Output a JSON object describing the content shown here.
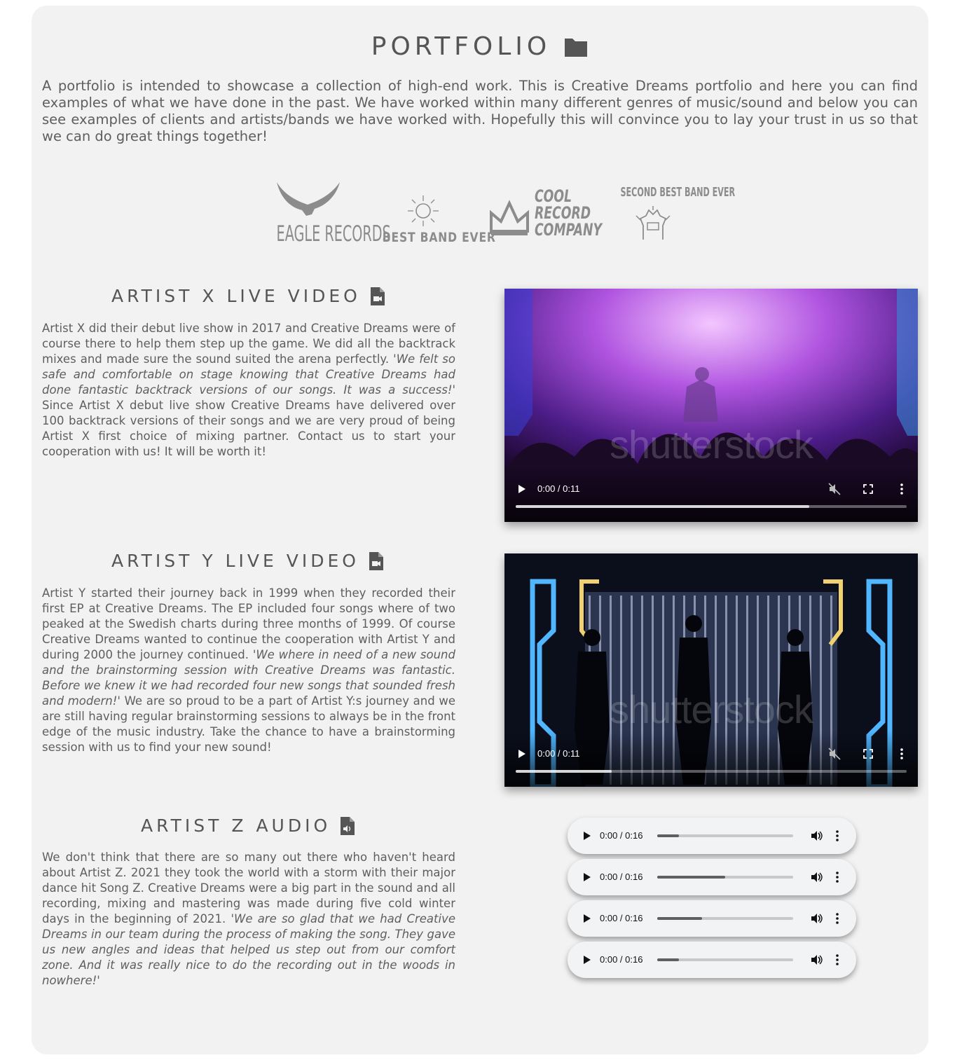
{
  "portfolio": {
    "title": "PORTFOLIO",
    "title_icon": "folder-icon",
    "intro": "A portfolio is intended to showcase a collection of high-end work. This is Creative Dreams portfolio and here you can find examples of what we have done in the past. We have worked within many different genres of music/sound and below you can see examples of clients and artists/bands we have worked with. Hopefully this will convince you to lay your trust in us so that we can do great things together!"
  },
  "logos": {
    "eagle": "EAGLE RECORDS",
    "best_band": "BEST BAND EVER",
    "cool_record": [
      "COOL",
      "RECORD",
      "COMPANY"
    ],
    "second_best": "SECOND BEST BAND EVER"
  },
  "artist_x": {
    "title": "ARTIST X LIVE VIDEO",
    "icon": "file-video-icon",
    "text_before": "Artist X did their debut live show in 2017 and Creative Dreams were of course there to help them step up the game. We did all the backtrack mixes and made sure the sound suited the arena perfectly. ",
    "quote": "'We felt so safe and comfortable on stage knowing that Creative Dreams had done fantastic backtrack versions of our songs. It was a success!'",
    "text_after": " Since Artist X debut live show Creative Dreams have delivered over 100 backtrack versions of their songs and we are very proud of being Artist X first choice of mixing partner. Contact us to start your cooperation with us! It will be worth it!",
    "video": {
      "time": "0:00 / 0:11",
      "watermark": "shutterstock",
      "buffered": 0.75
    }
  },
  "artist_y": {
    "title": "ARTIST Y LIVE VIDEO",
    "icon": "file-video-icon",
    "text_before": "Artist Y started their journey back in 1999 when they recorded their first EP at Creative Dreams. The EP included four songs where of two peaked at the Swedish charts during three months of 1999. Of course Creative Dreams wanted to continue the cooperation with Artist Y and during 2000 the journey continued. ",
    "quote": "'We where in need of a new sound and the brainstorming session with Creative Dreams was fantastic. Before we knew it we had recorded four new songs that sounded fresh and modern!'",
    "text_after": " We are so proud to be a part of Artist Y:s journey and we are still having regular brainstorming sessions to always be in the front edge of the music industry. Take the chance to have a brainstorming session with us to find your new sound!",
    "video": {
      "time": "0:00 / 0:11",
      "watermark": "shutterstock",
      "buffered": 0.245
    }
  },
  "artist_z": {
    "title": "ARTIST Z AUDIO",
    "icon": "file-audio-icon",
    "text_before": "We don't think that there are so many out there who haven't heard about Artist Z. 2021 they took the world with a storm with their major dance hit Song Z. Creative Dreams were a big part in the sound and all recording, mixing and mastering was made during five cold winter days in the beginning of 2021. ",
    "quote": "'We are so glad that we had Creative Dreams in our team during the process of making the song. They gave us new angles and ideas that helped us step out from our comfort zone. And it was really nice to do the recording out in the woods in nowhere!'",
    "text_after": "",
    "audio_players": [
      {
        "time": "0:00 / 0:16",
        "buffered": 0.16
      },
      {
        "time": "0:00 / 0:16",
        "buffered": 0.5
      },
      {
        "time": "0:00 / 0:16",
        "buffered": 0.33
      },
      {
        "time": "0:00 / 0:16",
        "buffered": 0.16
      }
    ]
  }
}
